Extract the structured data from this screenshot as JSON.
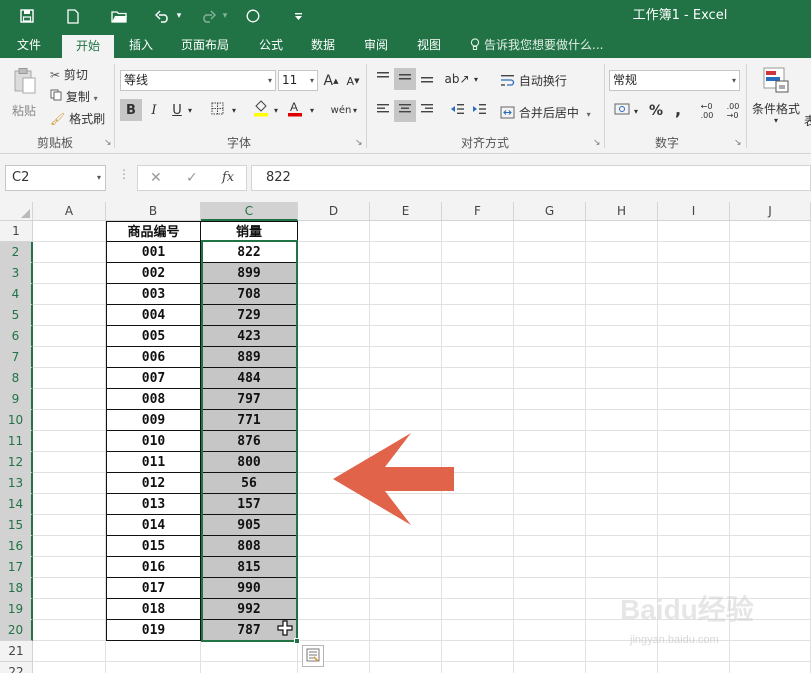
{
  "window": {
    "title": "工作簿1 - Excel"
  },
  "qat": {
    "dropdown_arrow": "▾"
  },
  "tabs": [
    {
      "label": "文件"
    },
    {
      "label": "开始"
    },
    {
      "label": "插入"
    },
    {
      "label": "页面布局"
    },
    {
      "label": "公式"
    },
    {
      "label": "数据"
    },
    {
      "label": "审阅"
    },
    {
      "label": "视图"
    }
  ],
  "tell_me": {
    "text": "告诉我您想要做什么..."
  },
  "ribbon": {
    "clipboard": {
      "paste_label": "粘贴",
      "cut_label": "剪切",
      "copy_label": "复制",
      "format_painter_label": "格式刷",
      "group_label": "剪贴板"
    },
    "font": {
      "font_name": "等线",
      "font_size": "11",
      "grow_label": "A",
      "shrink_label": "A",
      "bold": "B",
      "italic": "I",
      "underline": "U",
      "phonetic": "wén",
      "group_label": "字体"
    },
    "alignment": {
      "wrap_text_label": "自动换行",
      "merge_center_label": "合并后居中",
      "group_label": "对齐方式"
    },
    "number": {
      "format": "常规",
      "percent": "%",
      "comma": ",",
      "group_label": "数字"
    },
    "styles": {
      "conditional_label": "条件格式",
      "overflow_label": "表"
    }
  },
  "formula_bar": {
    "name_box": "C2",
    "cancel": "✕",
    "enter": "✓",
    "fx": "fx",
    "value": "822"
  },
  "grid": {
    "columns": [
      "A",
      "B",
      "C",
      "D",
      "E",
      "F",
      "G",
      "H",
      "I",
      "J"
    ],
    "rows": [
      "1",
      "2",
      "3",
      "4",
      "5",
      "6",
      "7",
      "8",
      "9",
      "10",
      "11",
      "12",
      "13",
      "14",
      "15",
      "16",
      "17",
      "18",
      "19",
      "20",
      "21",
      "22"
    ],
    "table_headers": [
      "商品编号",
      "销量"
    ],
    "table_rows": [
      [
        "001",
        "822"
      ],
      [
        "002",
        "899"
      ],
      [
        "003",
        "708"
      ],
      [
        "004",
        "729"
      ],
      [
        "005",
        "423"
      ],
      [
        "006",
        "889"
      ],
      [
        "007",
        "484"
      ],
      [
        "008",
        "797"
      ],
      [
        "009",
        "771"
      ],
      [
        "010",
        "876"
      ],
      [
        "011",
        "800"
      ],
      [
        "012",
        "56"
      ],
      [
        "013",
        "157"
      ],
      [
        "014",
        "905"
      ],
      [
        "015",
        "808"
      ],
      [
        "016",
        "815"
      ],
      [
        "017",
        "990"
      ],
      [
        "018",
        "992"
      ],
      [
        "019",
        "787"
      ]
    ]
  },
  "colors": {
    "excel_green": "#217346",
    "arrow": "#e0634a",
    "selection_fill": "#c6c6c6"
  },
  "watermark": {
    "text": "Baidu经验",
    "sub": "jingyan.baidu.com"
  }
}
